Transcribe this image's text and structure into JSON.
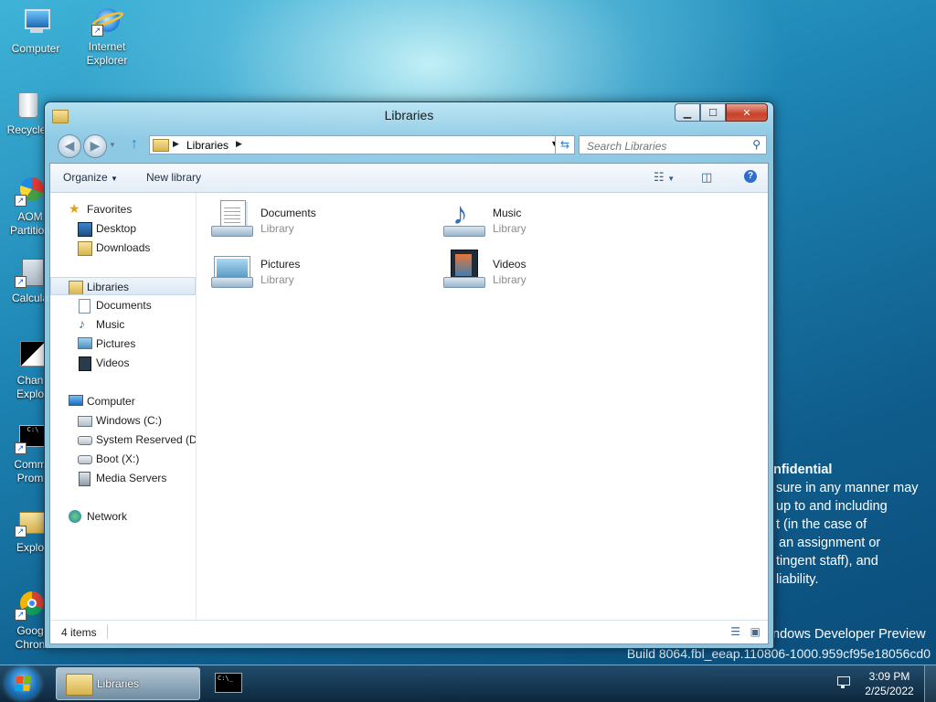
{
  "desktop": {
    "icons": [
      {
        "label": "Computer",
        "name": "computer-icon"
      },
      {
        "label": "Internet\nExplorer",
        "name": "internet-explorer-icon"
      },
      {
        "label": "Recycle",
        "name": "recycle-bin-icon"
      },
      {
        "label": "AOM\nPartition",
        "name": "aomei-partition-icon"
      },
      {
        "label": "Calcula",
        "name": "calculator-icon"
      },
      {
        "label": "Chan\nExplo",
        "name": "change-explorer-icon"
      },
      {
        "label": "Comm\nProm",
        "name": "command-prompt-icon"
      },
      {
        "label": "Explo",
        "name": "explorer-icon"
      },
      {
        "label": "Goog\nChron",
        "name": "google-chrome-icon"
      }
    ],
    "watermark": {
      "lines": [
        "nfidential",
        "sure in any manner may",
        "up to and including",
        "t (in the case of",
        "an assignment or",
        "tingent staff), and",
        "liability."
      ],
      "product": "ndows Developer Preview",
      "build": "Build 8064.fbl_eeap.110806-1000.959cf95e18056cd0"
    }
  },
  "window": {
    "title": "Libraries",
    "address": {
      "breadcrumb": "Libraries"
    },
    "search": {
      "placeholder": "Search Libraries"
    },
    "commands": {
      "organize": "Organize",
      "new_library": "New library"
    },
    "nav": {
      "favorites": "Favorites",
      "desktop": "Desktop",
      "downloads": "Downloads",
      "libraries": "Libraries",
      "documents": "Documents",
      "music": "Music",
      "pictures": "Pictures",
      "videos": "Videos",
      "computer": "Computer",
      "windows_c": "Windows (C:)",
      "system_reserved": "System Reserved (D:",
      "boot_x": "Boot (X:)",
      "media_servers": "Media Servers",
      "network": "Network"
    },
    "items": [
      {
        "name": "Documents",
        "type": "Library"
      },
      {
        "name": "Music",
        "type": "Library"
      },
      {
        "name": "Pictures",
        "type": "Library"
      },
      {
        "name": "Videos",
        "type": "Library"
      }
    ],
    "status": {
      "count": "4 items"
    }
  },
  "taskbar": {
    "active_button": "Libraries",
    "time": "3:09 PM",
    "date": "2/25/2022"
  },
  "colors": {
    "accent": "#1d6fb4",
    "desktop": "#1e86b5"
  }
}
